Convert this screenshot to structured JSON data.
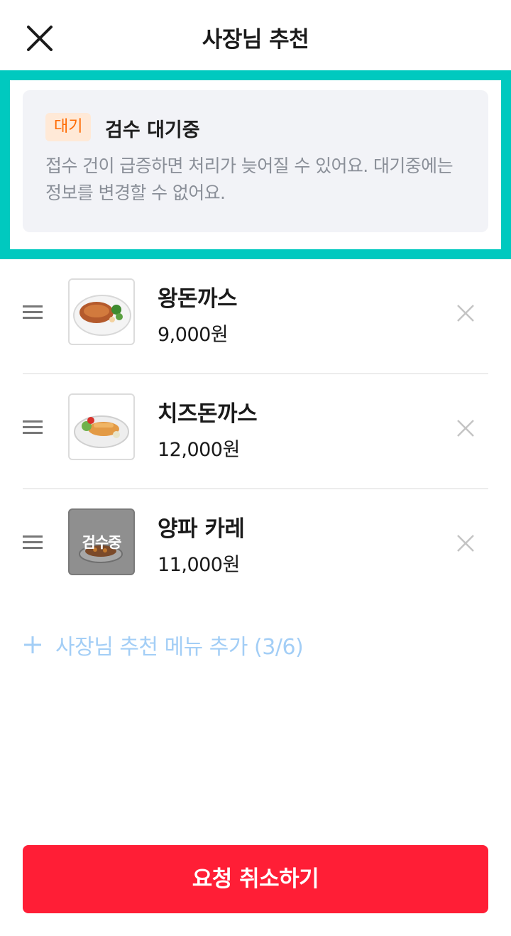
{
  "header": {
    "title": "사장님 추천",
    "close_icon": "close-icon"
  },
  "status": {
    "badge": "대기",
    "title": "검수 대기중",
    "description": "접수 건이 급증하면 처리가 늦어질 수 있어요. 대기중에는 정보를 변경할 수 없어요.",
    "highlight_color": "#00c9bf",
    "badge_color": "#ff6a00"
  },
  "menu_items": [
    {
      "name": "왕돈까스",
      "price": "9,000원",
      "reviewing": false,
      "review_label": ""
    },
    {
      "name": "치즈돈까스",
      "price": "12,000원",
      "reviewing": false,
      "review_label": ""
    },
    {
      "name": "양파 카레",
      "price": "11,000원",
      "reviewing": true,
      "review_label": "검수중"
    }
  ],
  "add_menu": {
    "label": "사장님 추천 메뉴 추가 (3/6)",
    "icon": "plus-icon"
  },
  "bottom_button": {
    "label": "요청 취소하기",
    "color": "#ff1e36"
  }
}
